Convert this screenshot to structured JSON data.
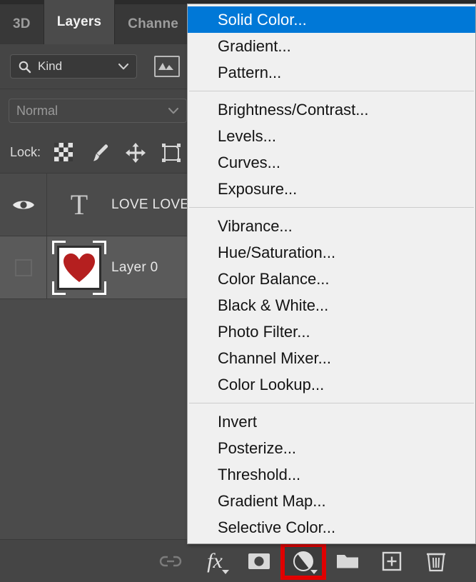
{
  "panel": {
    "tabs": [
      {
        "label": "3D",
        "active": false
      },
      {
        "label": "Layers",
        "active": true
      },
      {
        "label": "Channe",
        "active": false
      }
    ],
    "filter": {
      "search_icon": "search-icon",
      "kind_value": "Kind",
      "chevron": "chevron-down-icon",
      "pixel_filter_icon": "image-filter-icon"
    },
    "blend": {
      "mode_value": "Normal",
      "chevron": "chevron-down-icon"
    },
    "lock": {
      "label": "Lock:",
      "icons": [
        {
          "name": "transparent-pixels-icon"
        },
        {
          "name": "image-pixels-brush-icon"
        },
        {
          "name": "position-move-icon"
        },
        {
          "name": "artboard-nesting-icon"
        }
      ]
    },
    "layers": [
      {
        "name": "LOVE LOVE",
        "visible": true,
        "selected": false,
        "thumb_type": "text",
        "thumb_glyph": "T"
      },
      {
        "name": "Layer 0",
        "visible": false,
        "selected": true,
        "thumb_type": "image",
        "thumb_shape": "heart"
      }
    ],
    "toolbar": [
      {
        "name": "link-layers-icon",
        "label": "Link layers",
        "dimmed": true,
        "caret": false,
        "highlighted": false
      },
      {
        "name": "layer-style-fx-icon",
        "label": "fx",
        "dimmed": false,
        "caret": true,
        "highlighted": false
      },
      {
        "name": "layer-mask-icon",
        "label": "Add layer mask",
        "dimmed": false,
        "caret": false,
        "highlighted": false
      },
      {
        "name": "adjustment-layer-icon",
        "label": "Create new fill or adjustment layer",
        "dimmed": false,
        "caret": true,
        "highlighted": true
      },
      {
        "name": "new-group-folder-icon",
        "label": "Create a new group",
        "dimmed": false,
        "caret": false,
        "highlighted": false
      },
      {
        "name": "new-layer-icon",
        "label": "Create a new layer",
        "dimmed": false,
        "caret": false,
        "highlighted": false
      },
      {
        "name": "delete-layer-trash-icon",
        "label": "Delete layer",
        "dimmed": false,
        "caret": false,
        "highlighted": false
      }
    ]
  },
  "context_menu": {
    "groups": [
      {
        "items": [
          {
            "label": "Solid Color...",
            "highlighted": true
          },
          {
            "label": "Gradient...",
            "highlighted": false
          },
          {
            "label": "Pattern...",
            "highlighted": false
          }
        ]
      },
      {
        "items": [
          {
            "label": "Brightness/Contrast...",
            "highlighted": false
          },
          {
            "label": "Levels...",
            "highlighted": false
          },
          {
            "label": "Curves...",
            "highlighted": false
          },
          {
            "label": "Exposure...",
            "highlighted": false
          }
        ]
      },
      {
        "items": [
          {
            "label": "Vibrance...",
            "highlighted": false
          },
          {
            "label": "Hue/Saturation...",
            "highlighted": false
          },
          {
            "label": "Color Balance...",
            "highlighted": false
          },
          {
            "label": "Black & White...",
            "highlighted": false
          },
          {
            "label": "Photo Filter...",
            "highlighted": false
          },
          {
            "label": "Channel Mixer...",
            "highlighted": false
          },
          {
            "label": "Color Lookup...",
            "highlighted": false
          }
        ]
      },
      {
        "items": [
          {
            "label": "Invert",
            "highlighted": false
          },
          {
            "label": "Posterize...",
            "highlighted": false
          },
          {
            "label": "Threshold...",
            "highlighted": false
          },
          {
            "label": "Gradient Map...",
            "highlighted": false
          },
          {
            "label": "Selective Color...",
            "highlighted": false
          }
        ]
      }
    ]
  },
  "colors": {
    "panel_bg": "#4b4b4b",
    "tabstrip_bg": "#2b2b2b",
    "row_bg": "#454545",
    "selected_row": "#5a5a5a",
    "menu_bg": "#f0f0f0",
    "menu_highlight": "#0078d7",
    "callout_red": "#e00000",
    "heart_red": "#b51f1f",
    "text_light": "#e8e8e8"
  }
}
